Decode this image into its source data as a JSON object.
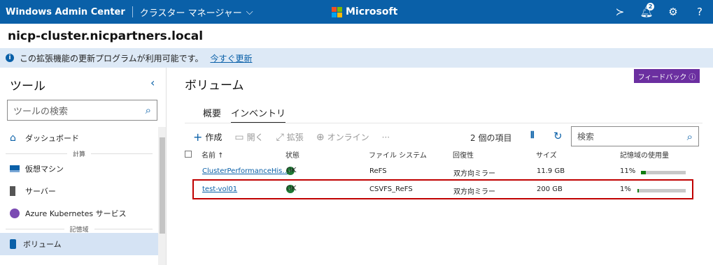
{
  "topbar": {
    "app_title": "Windows Admin Center",
    "context_title": "クラスター マネージャー",
    "brand": "Microsoft",
    "notification_count": "2",
    "icons": [
      "terminal-icon",
      "bell-icon",
      "gear-icon",
      "help-icon"
    ]
  },
  "cluster_name": "nicp-cluster.nicpartners.local",
  "banner": {
    "text": "この拡張機能の更新プログラムが利用可能です。",
    "link": "今すぐ更新"
  },
  "sidebar": {
    "title": "ツール",
    "search_placeholder": "ツールの検索",
    "items": [
      {
        "label": "ダッシュボード",
        "icon": "home-icon"
      },
      {
        "group": "計算"
      },
      {
        "label": "仮想マシン",
        "icon": "monitor-icon"
      },
      {
        "label": "サーバー",
        "icon": "server-icon"
      },
      {
        "label": "Azure Kubernetes サービス",
        "icon": "kubernetes-icon"
      },
      {
        "group": "記憶域"
      },
      {
        "label": "ボリューム",
        "icon": "volume-icon",
        "active": true
      }
    ]
  },
  "main": {
    "title": "ボリューム",
    "feedback": "フィードバック",
    "tabs": [
      "概要",
      "インベントリ"
    ],
    "active_tab": "インベントリ",
    "toolbar": {
      "create": "作成",
      "open": "開く",
      "expand": "拡張",
      "online": "オンライン",
      "more": "···"
    },
    "item_count": "2 個の項目",
    "search_placeholder": "検索",
    "columns": [
      "名前 ↑",
      "状態",
      "ファイル システム",
      "回復性",
      "サイズ",
      "記憶域の使用量"
    ],
    "rows": [
      {
        "name": "ClusterPerformanceHis…",
        "status": "OK",
        "fs": "ReFS",
        "resiliency": "双方向ミラー",
        "size": "11.9 GB",
        "usage_label": "11%",
        "usage": 0.11
      },
      {
        "name": "test-vol01",
        "status": "OK",
        "fs": "CSVFS_ReFS",
        "resiliency": "双方向ミラー",
        "size": "200 GB",
        "usage_label": "1%",
        "usage": 0.01
      }
    ]
  },
  "colors": {
    "topbar": "#0a60a8",
    "feedback": "#6b2fa0",
    "highlight": "#c00000",
    "ok": "#1f7a34"
  }
}
